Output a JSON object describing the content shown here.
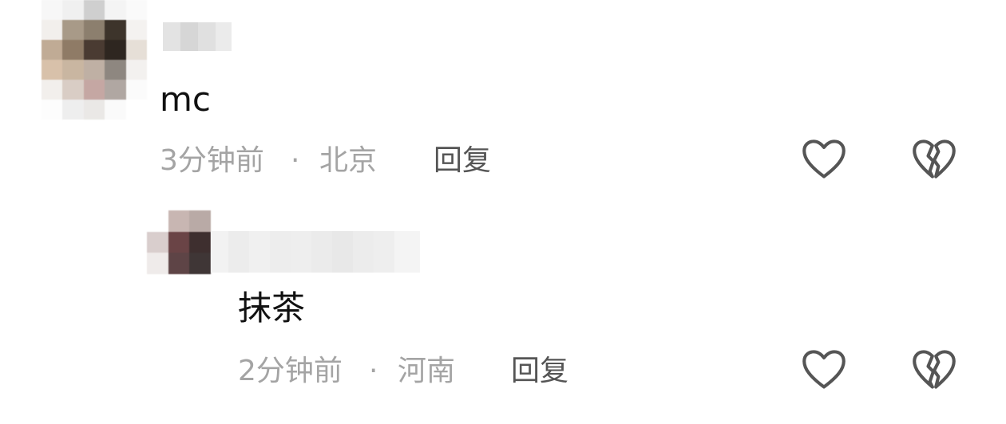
{
  "comments": [
    {
      "text": "mc",
      "time": "3分钟前",
      "separator": "·",
      "location": "北京",
      "reply_label": "回复",
      "like_icon": "heart-outline-icon",
      "dislike_icon": "broken-heart-outline-icon"
    },
    {
      "text": "抹茶",
      "time": "2分钟前",
      "separator": "·",
      "location": "河南",
      "reply_label": "回复",
      "like_icon": "heart-outline-icon",
      "dislike_icon": "broken-heart-outline-icon"
    }
  ],
  "colors": {
    "text": "#111111",
    "meta": "#a4a4a4",
    "reply": "#555555",
    "icon": "#555555",
    "background": "#ffffff"
  }
}
